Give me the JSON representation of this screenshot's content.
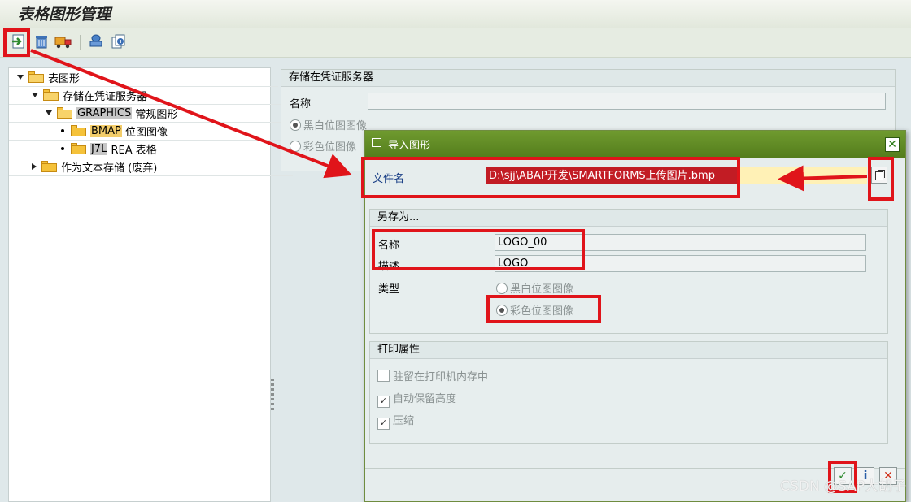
{
  "app": {
    "title": "表格图形管理"
  },
  "toolbar": {
    "icons": [
      "import-icon",
      "delete-icon",
      "transport-icon",
      "stamp-icon",
      "info-icon"
    ]
  },
  "tree": {
    "items": [
      {
        "label": "表图形",
        "indent": 0,
        "toggle": "down",
        "icon": "folder-open"
      },
      {
        "label": "存储在凭证服务器",
        "indent": 1,
        "toggle": "down",
        "icon": "folder-open"
      },
      {
        "code": "GRAPHICS",
        "label": "常规图形",
        "indent": 2,
        "toggle": "down",
        "icon": "folder-open"
      },
      {
        "code": "BMAP",
        "label": "位图图像",
        "indent": 3,
        "toggle": "dot",
        "icon": "folder"
      },
      {
        "code": "J7L",
        "label": "REA 表格",
        "indent": 3,
        "toggle": "dot",
        "icon": "folder"
      },
      {
        "label": "作为文本存储 (废弃)",
        "indent": 1,
        "toggle": "right",
        "icon": "folder"
      }
    ]
  },
  "background_group": {
    "title": "存储在凭证服务器",
    "name_label": "名称",
    "radio_bw": "黑白位图图像",
    "radio_color": "彩色位图像"
  },
  "dialog": {
    "title": "导入图形",
    "file_label": "文件名",
    "file_value": "D:\\sjj\\ABAP开发\\SMARTFORMS上传图片.bmp",
    "save_as": {
      "title": "另存为...",
      "name_label": "名称",
      "name_value": "LOGO_00",
      "desc_label": "描述",
      "desc_value": "LOGO",
      "type_label": "类型",
      "type_bw": "黑白位图图像",
      "type_color": "彩色位图图像",
      "selected": "color"
    },
    "print": {
      "title": "打印属性",
      "resident": {
        "label": "驻留在打印机内存中",
        "checked": false
      },
      "auto_height": {
        "label": "自动保留高度",
        "checked": true
      },
      "compress": {
        "label": "压缩",
        "checked": true
      }
    }
  },
  "watermark": "CSDN @SAP大胡子",
  "colors": {
    "highlight_red": "#e0141a",
    "dialog_title": "#5f8b24",
    "selection": "#c21c24"
  }
}
